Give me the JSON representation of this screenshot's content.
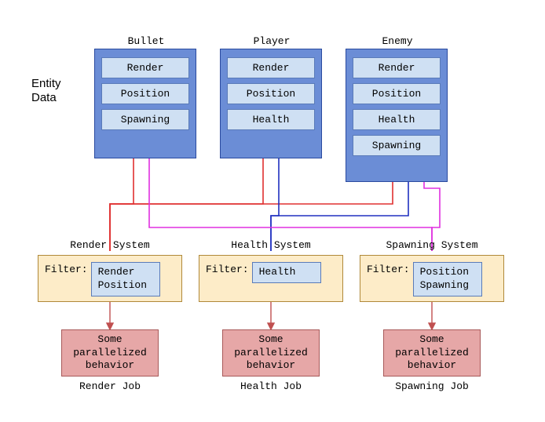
{
  "sideLabel": "Entity\nData",
  "entities": [
    {
      "title": "Bullet",
      "components": [
        "Render",
        "Position",
        "Spawning"
      ]
    },
    {
      "title": "Player",
      "components": [
        "Render",
        "Position",
        "Health"
      ]
    },
    {
      "title": "Enemy",
      "components": [
        "Render",
        "Position",
        "Health",
        "Spawning"
      ]
    }
  ],
  "systems": [
    {
      "title": "Render System",
      "filterLabel": "Filter:",
      "filters": [
        "Render",
        "Position"
      ]
    },
    {
      "title": "Health System",
      "filterLabel": "Filter:",
      "filters": [
        "Health"
      ]
    },
    {
      "title": "Spawning System",
      "filterLabel": "Filter:",
      "filters": [
        "Position",
        "Spawning"
      ]
    }
  ],
  "jobs": [
    {
      "text": "Some\nparallelized\nbehavior",
      "title": "Render Job"
    },
    {
      "text": "Some\nparallelized\nbehavior",
      "title": "Health Job"
    },
    {
      "text": "Some\nparallelized\nbehavior",
      "title": "Spawning Job"
    }
  ],
  "colors": {
    "renderLine": "#e03030",
    "healthLine": "#2030c0",
    "spawnLine": "#e030e0",
    "jobArrow": "#c05050"
  }
}
